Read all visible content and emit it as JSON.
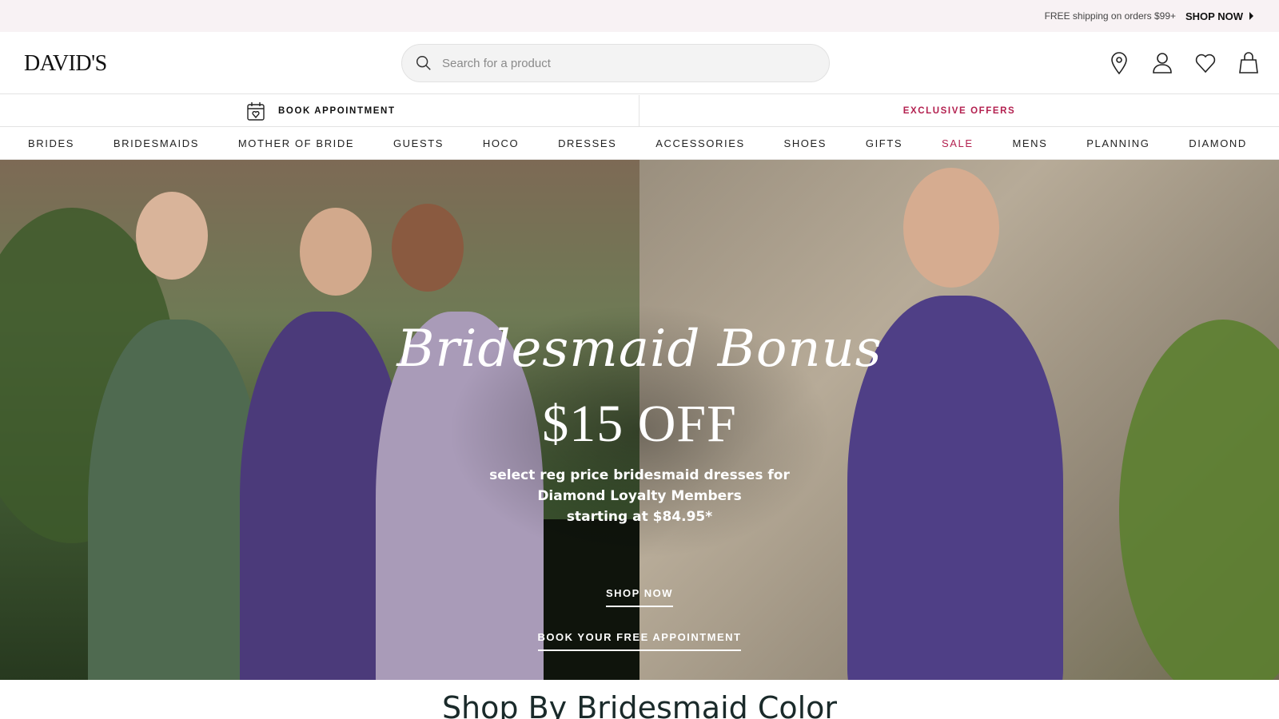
{
  "promo": {
    "text": "FREE shipping on orders $99+",
    "link": "SHOP NOW"
  },
  "header": {
    "logo": "DAVID'S",
    "search": {
      "placeholder": "Search for a product",
      "value": ""
    },
    "icons": [
      "location-icon",
      "account-icon",
      "wishlist-heart-icon",
      "shopping-bag-icon"
    ]
  },
  "subbar": {
    "book_appointment": "BOOK APPOINTMENT",
    "exclusive_offers": "EXCLUSIVE OFFERS"
  },
  "nav": {
    "items": [
      {
        "label": "BRIDES"
      },
      {
        "label": "BRIDESMAIDS"
      },
      {
        "label": "MOTHER OF BRIDE"
      },
      {
        "label": "GUESTS"
      },
      {
        "label": "HOCO"
      },
      {
        "label": "DRESSES"
      },
      {
        "label": "ACCESSORIES"
      },
      {
        "label": "SHOES"
      },
      {
        "label": "GIFTS"
      },
      {
        "label": "SALE"
      },
      {
        "label": "MENS"
      },
      {
        "label": "PLANNING"
      },
      {
        "label": "DIAMOND"
      }
    ]
  },
  "hero": {
    "script_title": "Bridesmaid Bonus",
    "offer": "$15 OFF",
    "desc_lines": [
      "select reg price bridesmaid dresses for",
      "Diamond Loyalty Members",
      "starting at $84.95*"
    ],
    "cta_primary": "SHOP NOW",
    "cta_secondary": "BOOK YOUR FREE APPOINTMENT"
  },
  "section": {
    "title": "Shop By Bridesmaid Color"
  },
  "colors": {
    "accent": "#b3204f",
    "promo_bg": "#f8f2f4",
    "text": "#111111"
  }
}
